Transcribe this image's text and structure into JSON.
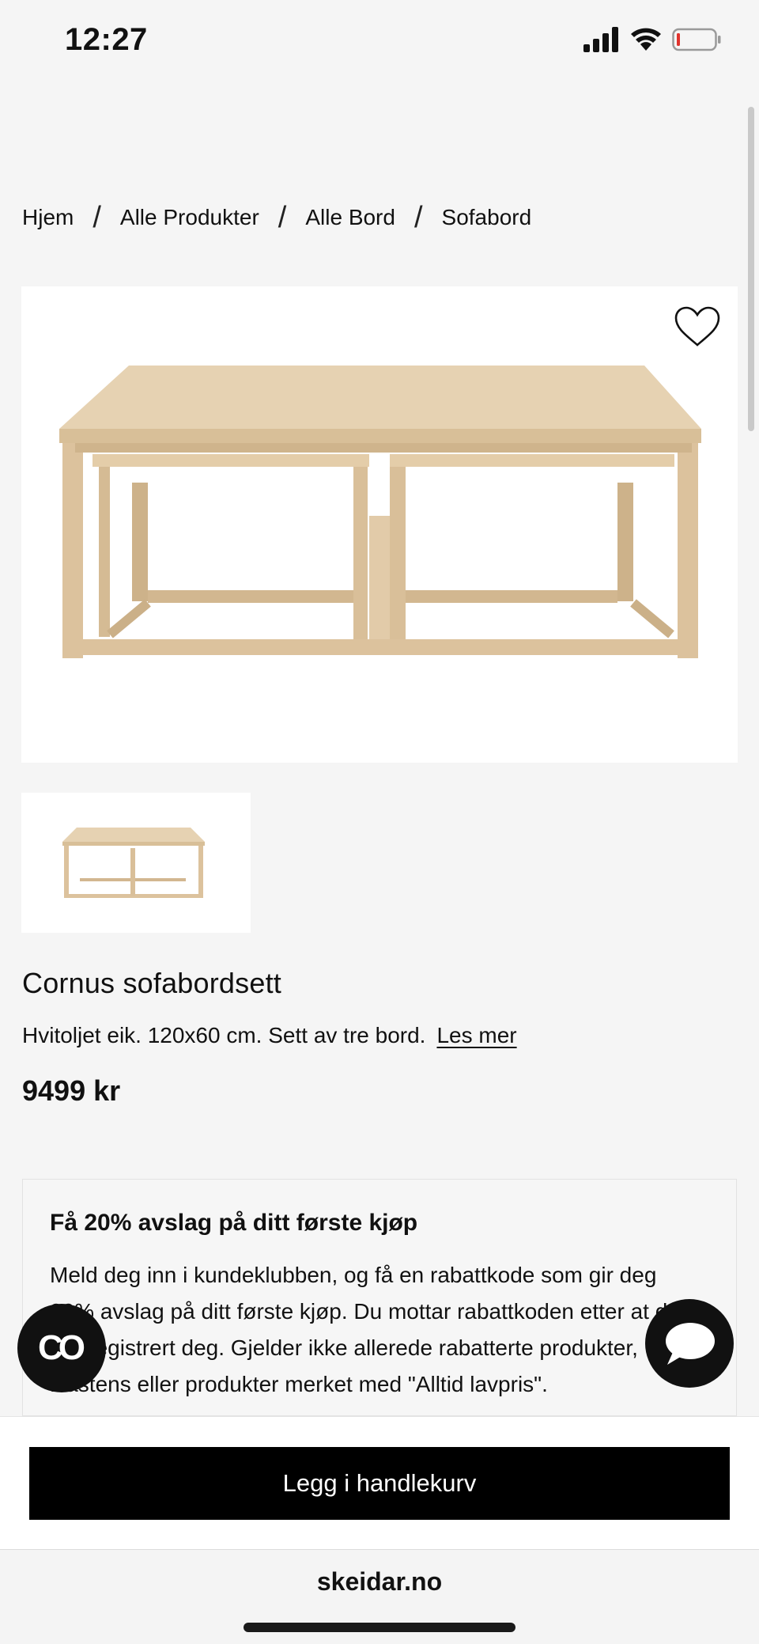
{
  "status_bar": {
    "time": "12:27"
  },
  "breadcrumb": {
    "items": [
      "Hjem",
      "Alle Produkter",
      "Alle Bord",
      "Sofabord"
    ],
    "separator": "/"
  },
  "product": {
    "title": "Cornus sofabordsett",
    "description": "Hvitoljet eik. 120x60 cm. Sett av tre bord.",
    "read_more": "Les mer",
    "price": "9499 kr"
  },
  "promo": {
    "title": "Få 20% avslag på ditt første kjøp",
    "text": "Meld deg inn i kundeklubben, og få en rabattkode som gir deg 20% avslag på ditt første kjøp. Du mottar rabattkoden etter at du har registrert deg. Gjelder ikke allerede rabatterte produkter, Hästens eller produkter merket med \"Alltid lavpris\"."
  },
  "floating": {
    "co_label": "CO"
  },
  "cart": {
    "button_label": "Legg i handlekurv"
  },
  "browser": {
    "url": "skeidar.no"
  },
  "icons": {
    "signal": "signal-icon",
    "wifi": "wifi-icon",
    "battery": "battery-icon",
    "heart": "heart-icon",
    "chat": "chat-icon"
  },
  "colors": {
    "background": "#f5f5f5",
    "button": "#000000",
    "battery_low": "#e0332d",
    "wood": "#e2cba9"
  }
}
